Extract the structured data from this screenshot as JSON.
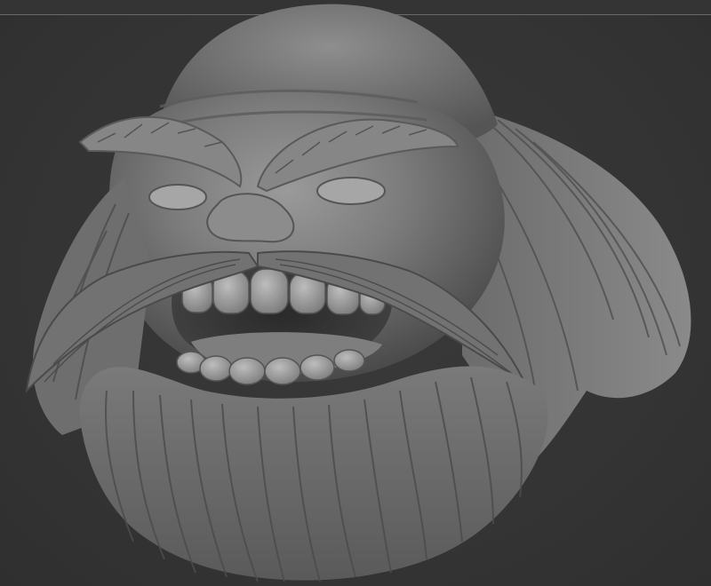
{
  "viewport": {
    "background_color": "#343434",
    "frame_line_color": "#6a6a6a",
    "model": {
      "name_icon": "sculpted-dwarf-head",
      "material_color": "#8a8a8a"
    }
  }
}
